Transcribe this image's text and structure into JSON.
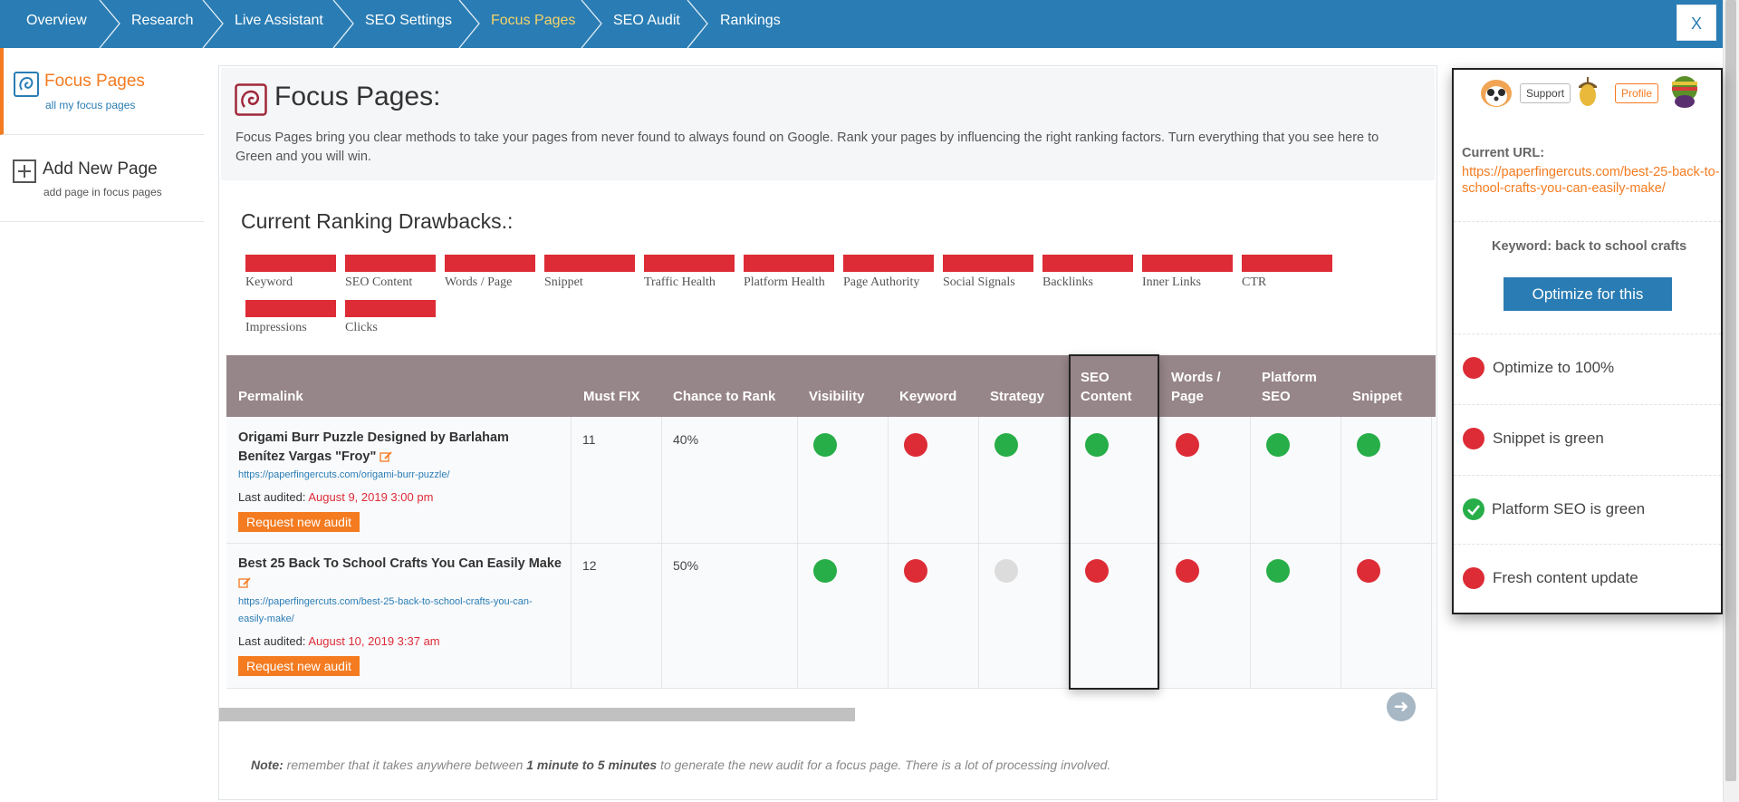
{
  "nav": {
    "items": [
      "Overview",
      "Research",
      "Live Assistant",
      "SEO Settings",
      "Focus Pages",
      "SEO Audit",
      "Rankings"
    ],
    "active_index": 4,
    "close_label": "X"
  },
  "sidebar": {
    "items": [
      {
        "title": "Focus Pages",
        "subtitle": "all my focus pages"
      },
      {
        "title": "Add New Page",
        "subtitle": "add page in focus pages"
      }
    ]
  },
  "main": {
    "title": "Focus Pages:",
    "intro": "Focus Pages bring you clear methods to take your pages from never found to always found on Google. Rank your pages by influencing the right ranking factors. Turn everything that you see here to Green and you will win.",
    "drawbacks_title": "Current Ranking Drawbacks.:",
    "drawbacks": [
      "Keyword",
      "SEO Content",
      "Words / Page",
      "Snippet",
      "Traffic Health",
      "Platform Health",
      "Page Authority",
      "Social Signals",
      "Backlinks",
      "Inner Links",
      "CTR",
      "Impressions",
      "Clicks"
    ]
  },
  "table": {
    "headers": [
      "Permalink",
      "Must FIX",
      "Chance to Rank",
      "Visibility",
      "Keyword",
      "Strategy",
      "SEO Content",
      "Words / Page",
      "Platform SEO",
      "Snippet"
    ],
    "rows": [
      {
        "title": "Origami Burr Puzzle Designed by Barlaham Benítez Vargas \"Froy\"",
        "url": "https://paperfingercuts.com/origami-burr-puzzle/",
        "last_audited_label": "Last audited:",
        "last_audited": "August 9, 2019 3:00 pm",
        "request_label": "Request new audit",
        "must_fix": "11",
        "chance": "40%",
        "statuses": [
          "green",
          "red",
          "green",
          "green",
          "red",
          "green",
          "green"
        ]
      },
      {
        "title": "Best 25 Back To School Crafts You Can Easily Make",
        "url": "https://paperfingercuts.com/best-25-back-to-school-crafts-you-can-easily-make/",
        "last_audited_label": "Last audited:",
        "last_audited": "August 10, 2019 3:37 am",
        "request_label": "Request new audit",
        "must_fix": "12",
        "chance": "50%",
        "statuses": [
          "green",
          "red",
          "grey",
          "red",
          "red",
          "green",
          "red"
        ]
      }
    ],
    "highlighted_column": "SEO Content"
  },
  "note": {
    "lead": "Note:",
    "text1": " remember that it takes anywhere between ",
    "bold1": "1 minute to 5 minutes",
    "text2": " to generate the new audit for a focus page. There is a lot of processing involved."
  },
  "assistant": {
    "support_label": "Support",
    "profile_label": "Profile",
    "current_url_label": "Current URL:",
    "current_url": "https://paperfingercuts.com/best-25-back-to-school-crafts-you-can-easily-make/",
    "keyword_label": "Keyword: back to school crafts",
    "optimize_button": "Optimize for this",
    "tasks": [
      {
        "label": "Optimize to 100%",
        "status": "red"
      },
      {
        "label": "Snippet is green",
        "status": "red"
      },
      {
        "label": "Platform SEO is green",
        "status": "done"
      },
      {
        "label": "Fresh content update",
        "status": "red"
      }
    ]
  },
  "colors": {
    "nav": "#2a7db4",
    "accent": "#f47b20",
    "red": "#dd2c36",
    "green": "#27ae48",
    "table_header": "#968589"
  }
}
